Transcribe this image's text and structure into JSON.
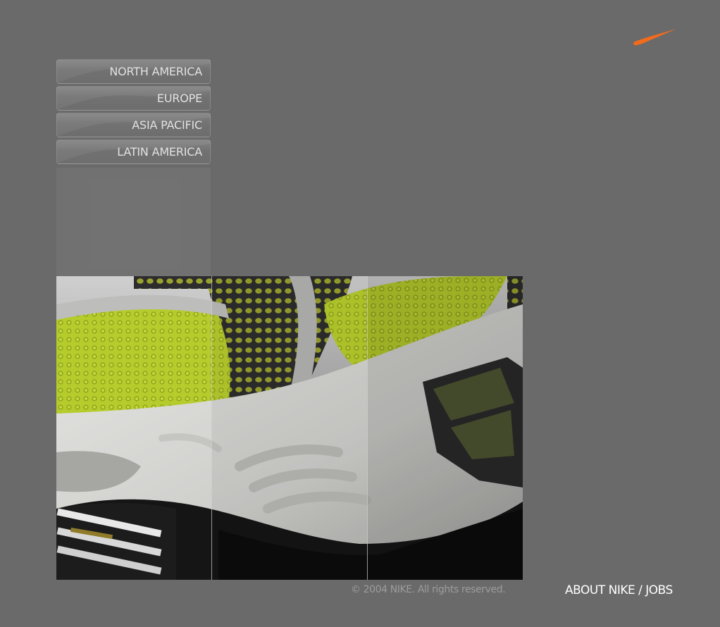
{
  "brand": {
    "logo_icon": "nike-swoosh-icon",
    "logo_color": "#f26b1d"
  },
  "regions": [
    {
      "label": "NORTH AMERICA"
    },
    {
      "label": "EUROPE"
    },
    {
      "label": "ASIA PACIFIC"
    },
    {
      "label": "LATIN AMERICA"
    }
  ],
  "hero": {
    "image_icon": "shoe-sole-closeup-image",
    "accent_color": "#b6cc2c"
  },
  "footer": {
    "copyright": "© 2004 NIKE. All rights reserved.",
    "about_label": "ABOUT NIKE",
    "separator": " / ",
    "jobs_label": "JOBS"
  },
  "colors": {
    "background": "#6a6a6a",
    "button_text": "#e2e2e2",
    "footer_text": "#ffffff",
    "copyright_text": "#9c9c9c"
  }
}
